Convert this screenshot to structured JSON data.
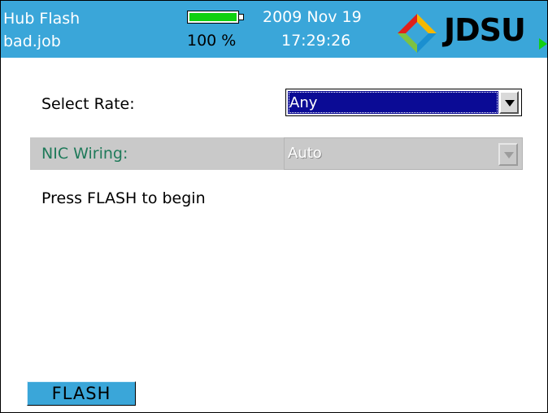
{
  "header": {
    "title": "Hub Flash",
    "job": "bad.job",
    "battery_percent": "100 %",
    "battery_level": 1.0,
    "date": "2009 Nov 19",
    "time": "17:29:26",
    "brand": "JDSU",
    "color": "#3aa6d9"
  },
  "form": {
    "rate_label": "Select Rate:",
    "rate_value": "Any",
    "wiring_label": "NIC Wiring:",
    "wiring_value": "Auto",
    "wiring_label_color": "#1f7a5a",
    "selected_color": "#0b0b95"
  },
  "status": {
    "message": "Press FLASH to begin"
  },
  "actions": {
    "flash_label": "FLASH"
  }
}
